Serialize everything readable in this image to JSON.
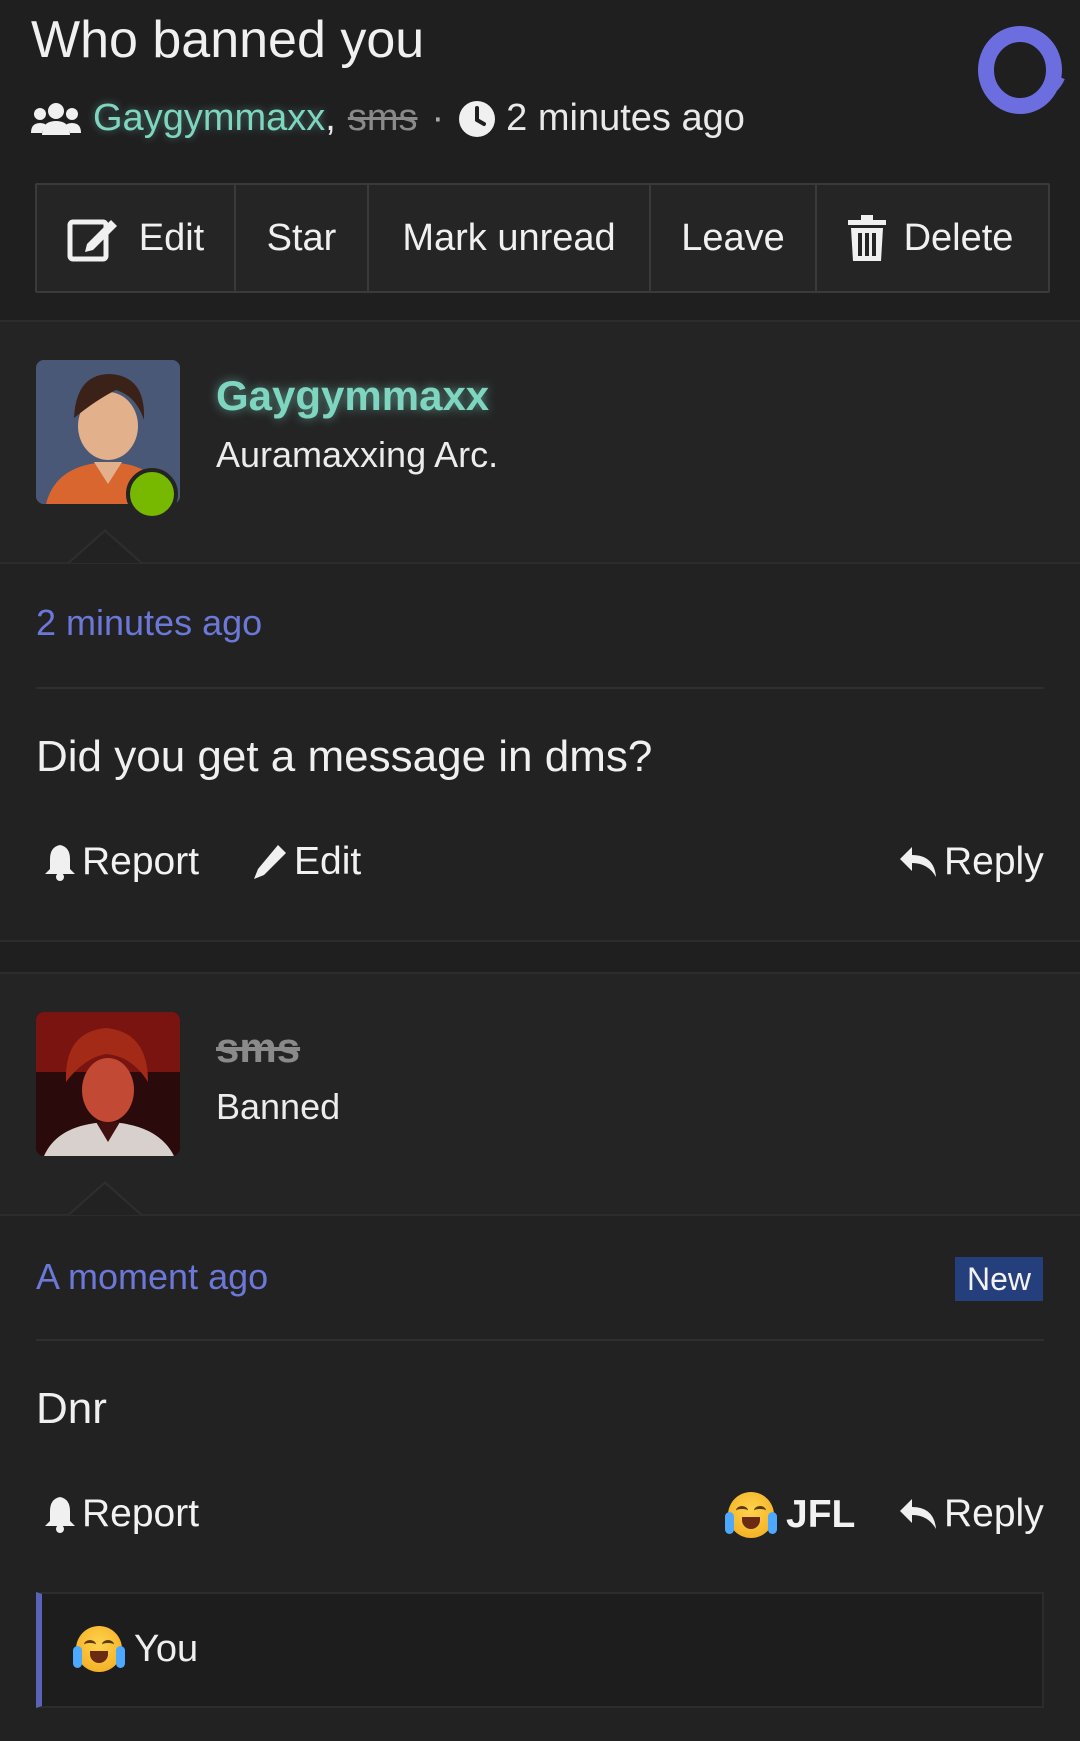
{
  "thread": {
    "title": "Who banned you",
    "participants": [
      "Gaygymmaxx",
      "sms"
    ],
    "separator": ",",
    "dot": "·",
    "started": "2 minutes ago"
  },
  "toolbar": {
    "edit": "Edit",
    "star": "Star",
    "mark_unread": "Mark unread",
    "leave": "Leave",
    "delete": "Delete"
  },
  "posts": [
    {
      "username": "Gaygymmaxx",
      "user_title": "Auramaxxing Arc.",
      "time": "2 minutes ago",
      "message": "Did you get a message in dms?",
      "actions": {
        "report": "Report",
        "edit": "Edit",
        "reply": "Reply"
      },
      "online": true
    },
    {
      "username": "sms",
      "user_title": "Banned",
      "time": "A moment ago",
      "badge": "New",
      "message": "Dnr",
      "actions": {
        "report": "Report",
        "reaction": "JFL",
        "reply": "Reply"
      },
      "reaction_summary": "You"
    }
  ],
  "colors": {
    "background": "#1f1f20",
    "accent": "#6c78d8",
    "username_green": "#7fd6c0",
    "online_dot": "#76b900",
    "new_badge": "#253f7c"
  },
  "icons": [
    "users-icon",
    "clock-icon",
    "edit-icon",
    "trash-icon",
    "bell-icon",
    "pencil-icon",
    "reply-icon",
    "joy-emoji-icon",
    "site-logo-icon"
  ]
}
